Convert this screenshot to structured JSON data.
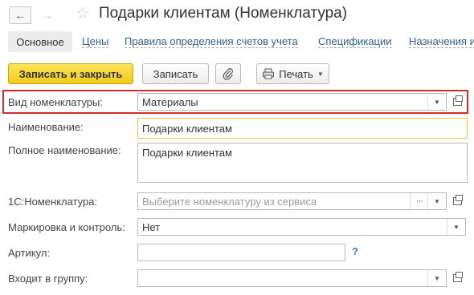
{
  "window": {
    "title": "Подарки клиентам (Номенклатура)",
    "back_icon": "←",
    "forward_icon": "→",
    "favorite_icon": "☆"
  },
  "tabs": [
    {
      "label": "Основное",
      "active": true
    },
    {
      "label": "Цены"
    },
    {
      "label": "Правила определения счетов учета"
    },
    {
      "label": "Спецификации"
    },
    {
      "label": "Назначения и"
    }
  ],
  "toolbar": {
    "save_close_label": "Записать и закрыть",
    "save_label": "Записать",
    "print_label": "Печать",
    "print_icon": "printer-icon",
    "attach_icon": "paperclip-icon"
  },
  "form": {
    "kind": {
      "label": "Вид номенклатуры:",
      "value": "Материалы"
    },
    "name": {
      "label": "Наименование:",
      "value": "Подарки клиентам"
    },
    "full_name": {
      "label": "Полное наименование:",
      "value": "Подарки клиентам"
    },
    "nomenclature_1c": {
      "label": "1С:Номенклатура:",
      "placeholder": "Выберите номенклатуру из сервиса"
    },
    "marking": {
      "label": "Маркировка и контроль:",
      "value": "Нет"
    },
    "article": {
      "label": "Артикул:",
      "value": "",
      "help": "?"
    },
    "group": {
      "label": "Входит в группу:",
      "value": ""
    }
  },
  "colors": {
    "primary_button": "#f5d532",
    "highlight_border": "#d42a2a",
    "active_field_border": "#e8c43a",
    "link": "#2f5f91"
  }
}
